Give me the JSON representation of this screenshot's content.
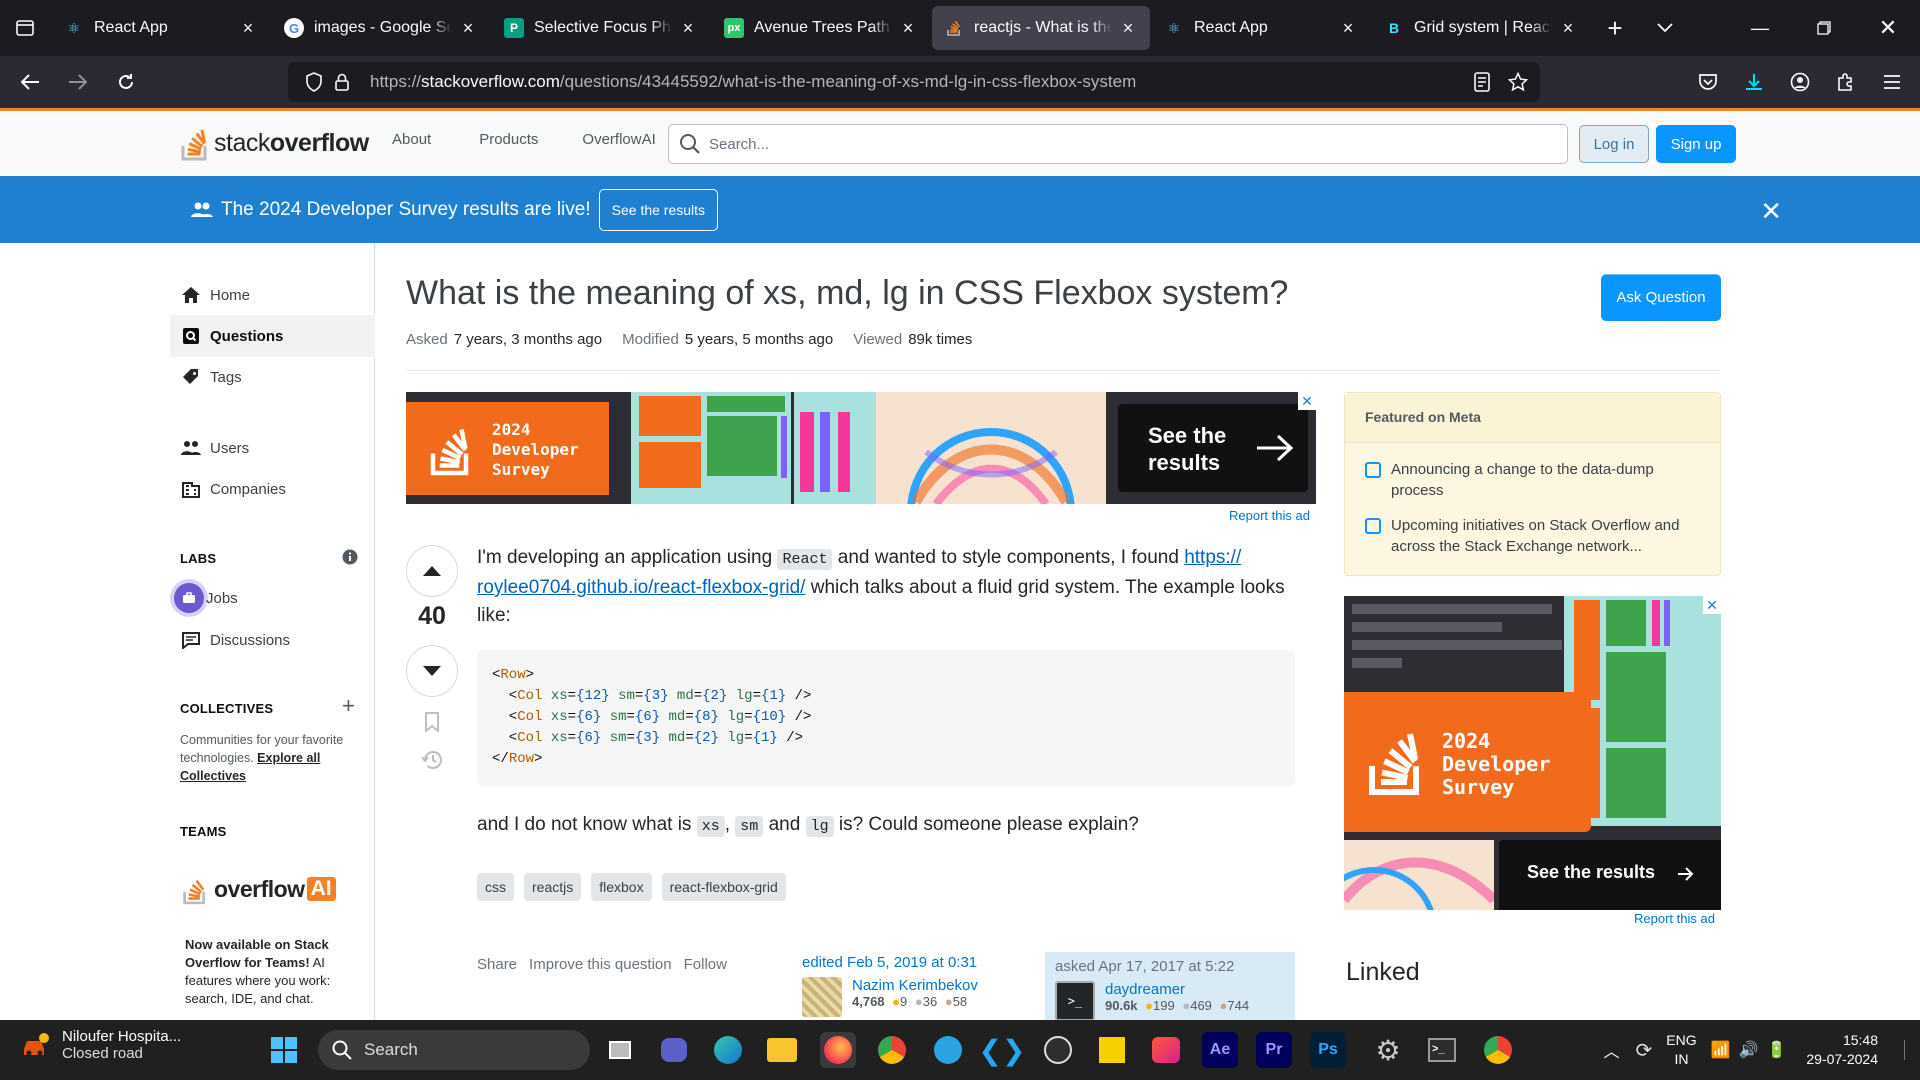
{
  "browser": {
    "tabs": [
      {
        "title": "React App",
        "icon": "react-icon",
        "active": false
      },
      {
        "title": "images - Google Search",
        "icon": "google-icon",
        "active": false
      },
      {
        "title": "Selective Focus Photography",
        "icon": "pexels-icon",
        "active": false
      },
      {
        "title": "Avenue Trees Path - Free",
        "icon": "pixabay-icon",
        "active": false
      },
      {
        "title": "reactjs - What is the meaning",
        "icon": "stackoverflow-icon",
        "active": true
      },
      {
        "title": "React App",
        "icon": "react-icon",
        "active": false
      },
      {
        "title": "Grid system | React Bootstrap",
        "icon": "bootstrap-icon",
        "active": false
      }
    ],
    "url_prefix": "https://",
    "url_domain": "stackoverflow.com",
    "url_path": "/questions/43445592/what-is-the-meaning-of-xs-md-lg-in-css-flexbox-system"
  },
  "so_header": {
    "logo_light": "stack",
    "logo_bold": "overflow",
    "nav": [
      "About",
      "Products",
      "OverflowAI"
    ],
    "search_placeholder": "Search...",
    "login": "Log in",
    "signup": "Sign up"
  },
  "banner": {
    "text": "The 2024 Developer Survey results are live!",
    "button": "See the results",
    "close": "✕"
  },
  "sidebar": {
    "items": [
      {
        "label": "Home",
        "icon": "home-icon"
      },
      {
        "label": "Questions",
        "icon": "questions-icon"
      },
      {
        "label": "Tags",
        "icon": "tag-icon"
      },
      {
        "label": "Users",
        "icon": "users-icon"
      },
      {
        "label": "Companies",
        "icon": "companies-icon"
      },
      {
        "label": "Jobs",
        "icon": "jobs-icon"
      },
      {
        "label": "Discussions",
        "icon": "discussions-icon"
      }
    ],
    "labs_heading": "LABS",
    "collectives_heading": "COLLECTIVES",
    "collectives_text": "Communities for your favorite technologies.",
    "collectives_link": "Explore all Collectives",
    "teams_heading": "TEAMS",
    "overflowai_word": "overflow",
    "overflowai_ai": "AI",
    "teams_bold": "Now available on Stack Overflow for Teams!",
    "teams_text": "AI features where you work: search, IDE, and chat."
  },
  "question": {
    "title": "What is the meaning of xs, md, lg in CSS Flexbox system?",
    "ask_button": "Ask Question",
    "asked_label": "Asked",
    "asked_value": "7 years, 3 months ago",
    "modified_label": "Modified",
    "modified_value": "5 years, 5 months ago",
    "viewed_label": "Viewed",
    "viewed_value": "89k times",
    "votes": "40",
    "body_1a": "I'm developing an application using",
    "body_1_code": "React",
    "body_1b": "and wanted to style components, I found",
    "body_1_link": "https://roylee0704.github.io/react-flexbox-grid/",
    "body_1_link_a": "https://",
    "body_1_link_b": "roylee0704.github.io/react-flexbox-grid/",
    "body_1c": "which talks about a fluid grid system. The example looks like:",
    "code_lines": [
      {
        "tag_open": "<",
        "tag": "Row",
        "tag_close": ">",
        "indent": ""
      },
      {
        "indent": "  ",
        "tag": "Col",
        "attrs": [
          [
            "xs",
            "{12}"
          ],
          [
            "sm",
            "{3}"
          ],
          [
            "md",
            "{2}"
          ],
          [
            "lg",
            "{1}"
          ]
        ]
      },
      {
        "indent": "  ",
        "tag": "Col",
        "attrs": [
          [
            "xs",
            "{6}"
          ],
          [
            "sm",
            "{6}"
          ],
          [
            "md",
            "{8}"
          ],
          [
            "lg",
            "{10}"
          ]
        ]
      },
      {
        "indent": "  ",
        "tag": "Col",
        "attrs": [
          [
            "xs",
            "{6}"
          ],
          [
            "sm",
            "{3}"
          ],
          [
            "md",
            "{2}"
          ],
          [
            "lg",
            "{1}"
          ]
        ]
      },
      {
        "closing": true,
        "tag": "Row"
      }
    ],
    "body_2a": "and I do not know what is",
    "body_2_code1": "xs",
    "body_2_code2": "sm",
    "body_2b": "and",
    "body_2_code3": "lg",
    "body_2c": "is? Could someone please explain?",
    "tags": [
      "css",
      "reactjs",
      "flexbox",
      "react-flexbox-grid"
    ],
    "actions": [
      "Share",
      "Improve this question",
      "Follow"
    ],
    "edited_label": "edited Feb 5, 2019 at 0:31",
    "editor_name": "Nazim Kerimbekov",
    "editor_rep": "4,768",
    "editor_gold": "9",
    "editor_silver": "36",
    "editor_bronze": "58",
    "asked_sig": "asked Apr 17, 2017 at 5:22",
    "author_name": "daydreamer",
    "author_rep": "90.6k",
    "author_gold": "199",
    "author_silver": "469",
    "author_bronze": "744"
  },
  "ads": {
    "survey_line1": "2024",
    "survey_line2": "Developer",
    "survey_line3": "Survey",
    "see_results": "See the results",
    "report": "Report this ad"
  },
  "featured_meta": {
    "heading": "Featured on Meta",
    "items": [
      "Announcing a change to the data-dump process",
      "Upcoming initiatives on Stack Overflow and across the Stack Exchange network..."
    ]
  },
  "linked": {
    "title": "Linked"
  },
  "taskbar": {
    "weather_title": "Niloufer Hospita...",
    "weather_sub": "Closed road",
    "search": "Search",
    "lang1": "ENG",
    "lang2": "IN",
    "time": "15:48",
    "date": "29-07-2024"
  }
}
